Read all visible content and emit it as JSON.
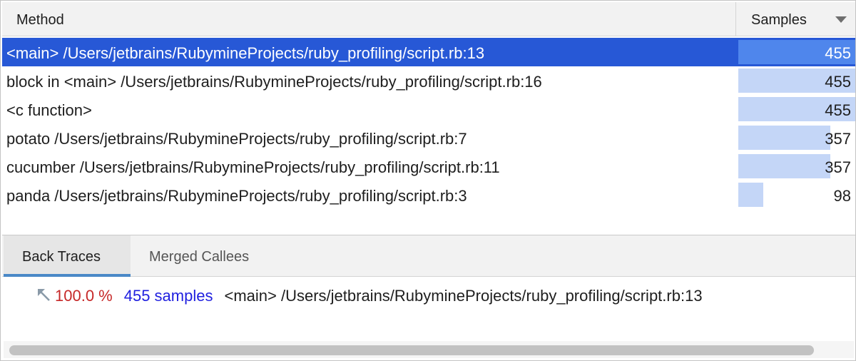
{
  "header": {
    "method_label": "Method",
    "samples_label": "Samples",
    "sort_icon": "chevron-down-icon"
  },
  "rows": [
    {
      "method": "<main> /Users/jetbrains/RubymineProjects/ruby_profiling/script.rb:13",
      "samples": "455",
      "fraction": 1.0,
      "selected": true
    },
    {
      "method": "block in <main> /Users/jetbrains/RubymineProjects/ruby_profiling/script.rb:16",
      "samples": "455",
      "fraction": 1.0,
      "selected": false
    },
    {
      "method": "<c function>",
      "samples": "455",
      "fraction": 1.0,
      "selected": false
    },
    {
      "method": "potato /Users/jetbrains/RubymineProjects/ruby_profiling/script.rb:7",
      "samples": "357",
      "fraction": 0.785,
      "selected": false
    },
    {
      "method": "cucumber /Users/jetbrains/RubymineProjects/ruby_profiling/script.rb:11",
      "samples": "357",
      "fraction": 0.785,
      "selected": false
    },
    {
      "method": "panda /Users/jetbrains/RubymineProjects/ruby_profiling/script.rb:3",
      "samples": "98",
      "fraction": 0.215,
      "selected": false
    }
  ],
  "tabs": [
    {
      "label": "Back Traces",
      "active": true
    },
    {
      "label": "Merged Callees",
      "active": false
    }
  ],
  "trace": {
    "icon": "arrow-up-left-icon",
    "percent": "100.0 %",
    "samples": "455 samples",
    "method": "<main> /Users/jetbrains/RubymineProjects/ruby_profiling/script.rb:13"
  },
  "colors": {
    "selection": "#2758d6",
    "bar": "#c4d6f7",
    "bar_selected": "#4f86ec",
    "percent": "#c62828",
    "samples": "#1f1fdf"
  }
}
